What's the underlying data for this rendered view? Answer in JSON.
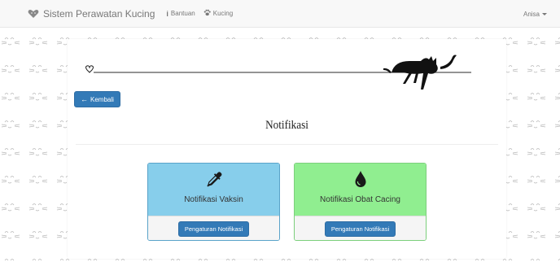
{
  "navbar": {
    "brand": "Sistem Perawatan Kucing",
    "links": [
      {
        "label": "Bantuan",
        "icon": "info-icon"
      },
      {
        "label": "Kucing",
        "icon": "paw-icon"
      }
    ],
    "user": "Anisa"
  },
  "main": {
    "back_label": "Kembali",
    "title": "Notifikasi",
    "cards": [
      {
        "title": "Notifikasi Vaksin",
        "button": "Pengaturan Notifikasi",
        "icon": "eyedropper-icon",
        "color": "#87ceeb"
      },
      {
        "title": "Notifikasi Obat Cacing",
        "button": "Pengaturan Notifikasi",
        "icon": "drop-icon",
        "color": "#90ee90"
      }
    ]
  },
  "colors": {
    "primary": "#337ab7",
    "navbar_bg": "#f8f8f8",
    "navbar_text": "#777777"
  }
}
